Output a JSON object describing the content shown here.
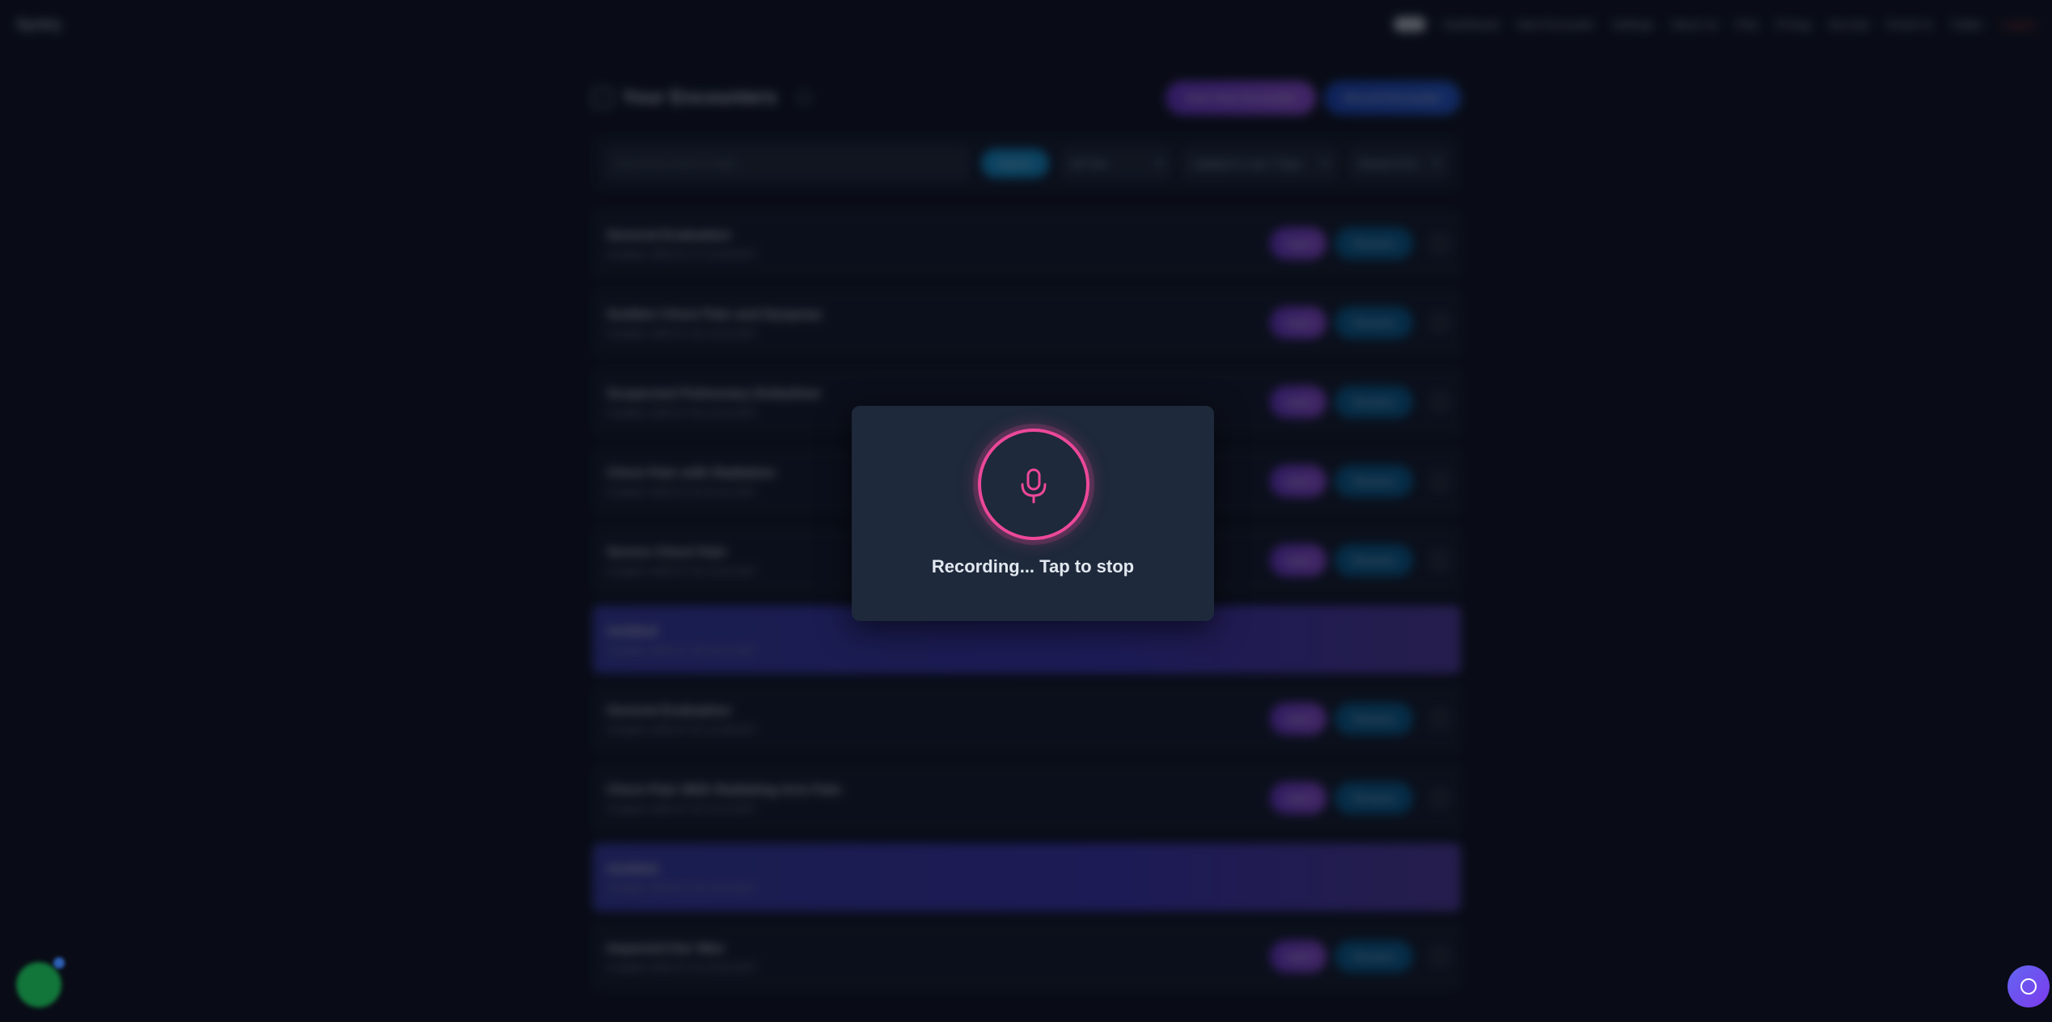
{
  "nav": {
    "brand": "Syntry",
    "links": [
      "Dashboard",
      "New Encounter",
      "Settings",
      "About Us",
      "FAQ",
      "Pricing",
      "Security",
      "Email Us",
      "Twitter",
      "Logout"
    ]
  },
  "header": {
    "title": "Your Encounters",
    "start_label": "Start New Encounter",
    "record_label": "Record Encounter"
  },
  "filters": {
    "search_placeholder": "Search by name or date...",
    "search_label": "Search",
    "time_filter": "All Time",
    "updated_filter": "Updated in Last 7 Days",
    "sort": "Newest First"
  },
  "encounters": [
    {
      "title": "General Evaluation",
      "created": "Created: 2025-07-27 22:09 EDT",
      "highlight": false
    },
    {
      "title": "Sudden Chest Pain and Dyspnea",
      "created": "Created: 2025-07-26 14:01 EDT",
      "highlight": false
    },
    {
      "title": "Suspected Pulmonary Embolism",
      "created": "Created: 2025-07-26 13:12 EDT",
      "highlight": false
    },
    {
      "title": "Chest Pain with Radiation",
      "created": "Created: 2025-07-25 22:11 EDT",
      "highlight": false
    },
    {
      "title": "Severe Chest Pain",
      "created": "Created: 2025-07-25 15:42 EDT",
      "highlight": false
    },
    {
      "title": "Untitled",
      "created": "Created: 2025-07-25 15:21 EDT",
      "highlight": true
    },
    {
      "title": "General Evaluation",
      "created": "Created: 2025-07-25 12:38 EDT",
      "highlight": false
    },
    {
      "title": "Chest Pain With Radiating Arm Pain",
      "created": "Created: 2025-07-25 11:01 EDT",
      "highlight": false
    },
    {
      "title": "Untitled",
      "created": "Created: 2025-07-25 10:53 EDT",
      "highlight": true
    },
    {
      "title": "Impacted Ear Wax",
      "created": "Created: 2025-07-25 10:02 EDT",
      "highlight": false
    }
  ],
  "row_actions": {
    "open": "Open",
    "rename": "Rename"
  },
  "modal": {
    "status_text": "Recording... Tap to stop"
  },
  "colors": {
    "accent_pink": "#ec4899",
    "modal_bg": "#1e293b",
    "page_bg": "#0b0f1a"
  }
}
